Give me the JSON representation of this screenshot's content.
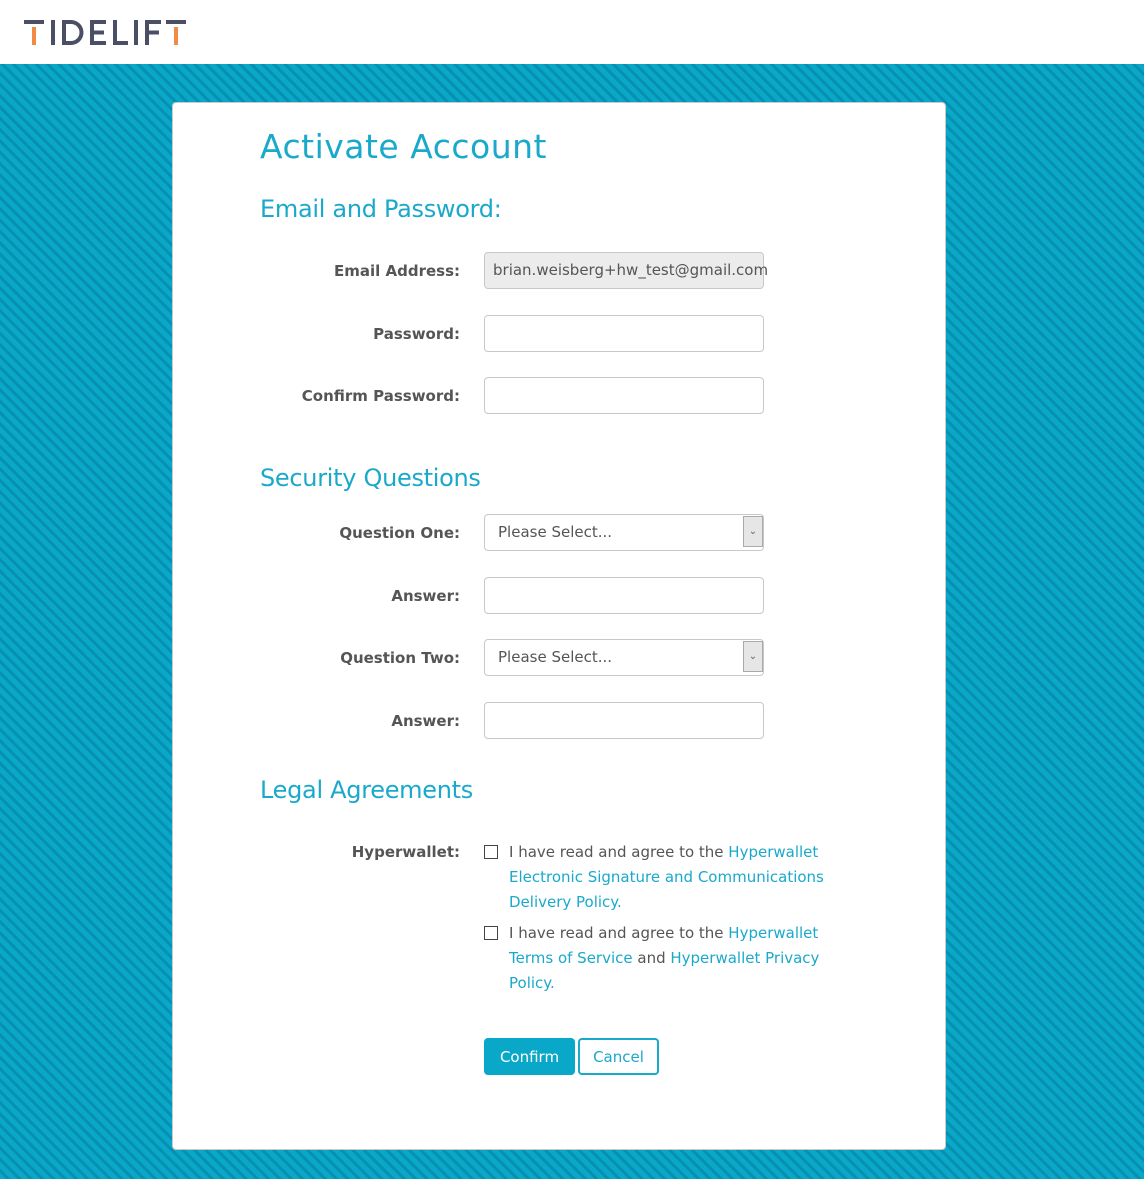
{
  "header": {
    "logo_text": "TIDELIFT",
    "brand_colors": {
      "text": "#4a4f66",
      "accent": "#f08a44"
    }
  },
  "background": {
    "color": "#0aa8c8"
  },
  "form": {
    "title": "Activate Account",
    "sections": {
      "email_password": {
        "title": "Email and Password:",
        "email_label": "Email Address:",
        "email_value": "brian.weisberg+hw_test@gmail.com",
        "password_label": "Password:",
        "password_value": "",
        "confirm_password_label": "Confirm Password:",
        "confirm_password_value": ""
      },
      "security": {
        "title": "Security Questions",
        "question_one_label": "Question One:",
        "question_one_value": "Please Select...",
        "answer_one_label": "Answer:",
        "answer_one_value": "",
        "question_two_label": "Question Two:",
        "question_two_value": "Please Select...",
        "answer_two_label": "Answer:",
        "answer_two_value": ""
      },
      "legal": {
        "title": "Legal Agreements",
        "hyperwallet_label": "Hyperwallet:",
        "agreement_one": {
          "prefix": "I have read and agree to the ",
          "link": "Hyperwallet Electronic Signature and Communications Delivery Policy.",
          "checked": false
        },
        "agreement_two": {
          "prefix": "I have read and agree to the ",
          "link_one": "Hyperwallet Terms of Service",
          "middle": " and ",
          "link_two": "Hyperwallet Privacy Policy.",
          "checked": false
        }
      }
    },
    "buttons": {
      "confirm": "Confirm",
      "cancel": "Cancel"
    },
    "accent_color": "#1aa9cb"
  }
}
